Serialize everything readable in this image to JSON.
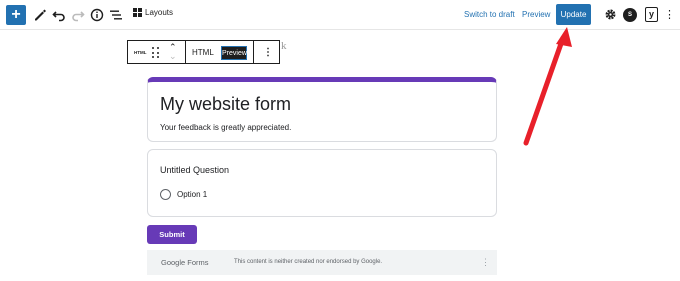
{
  "toolbar": {
    "inserter": "+",
    "layouts_label": "Layouts",
    "switch_to_draft": "Switch to draft",
    "preview": "Preview",
    "update": "Update",
    "badge": "S",
    "yoast": "y",
    "more": "⋮"
  },
  "block_toolbar": {
    "html_icon_label": "HTML",
    "html_tab": "HTML",
    "preview_tab": "Preview",
    "up": "⌃",
    "down": "⌄",
    "more": "⋮",
    "ghost_text": "k"
  },
  "form": {
    "title": "My website form",
    "description": "Your feedback is greatly appreciated.",
    "question_title": "Untitled Question",
    "option_1": "Option 1",
    "submit": "Submit",
    "footer_logo_a": "Google",
    "footer_logo_b": " Forms",
    "footer_disclaimer": "This content is neither created nor endorsed by Google.",
    "footer_more": "⋮"
  },
  "colors": {
    "wp_blue": "#2271b1",
    "forms_purple": "#673ab7",
    "annotation_red": "#e8202a"
  },
  "icons": [
    "inserter-icon",
    "pencil-icon",
    "undo-icon",
    "redo-icon",
    "info-icon",
    "list-view-icon",
    "layouts-icon",
    "gear-icon",
    "drag-handle-icon",
    "kebab-icon"
  ]
}
